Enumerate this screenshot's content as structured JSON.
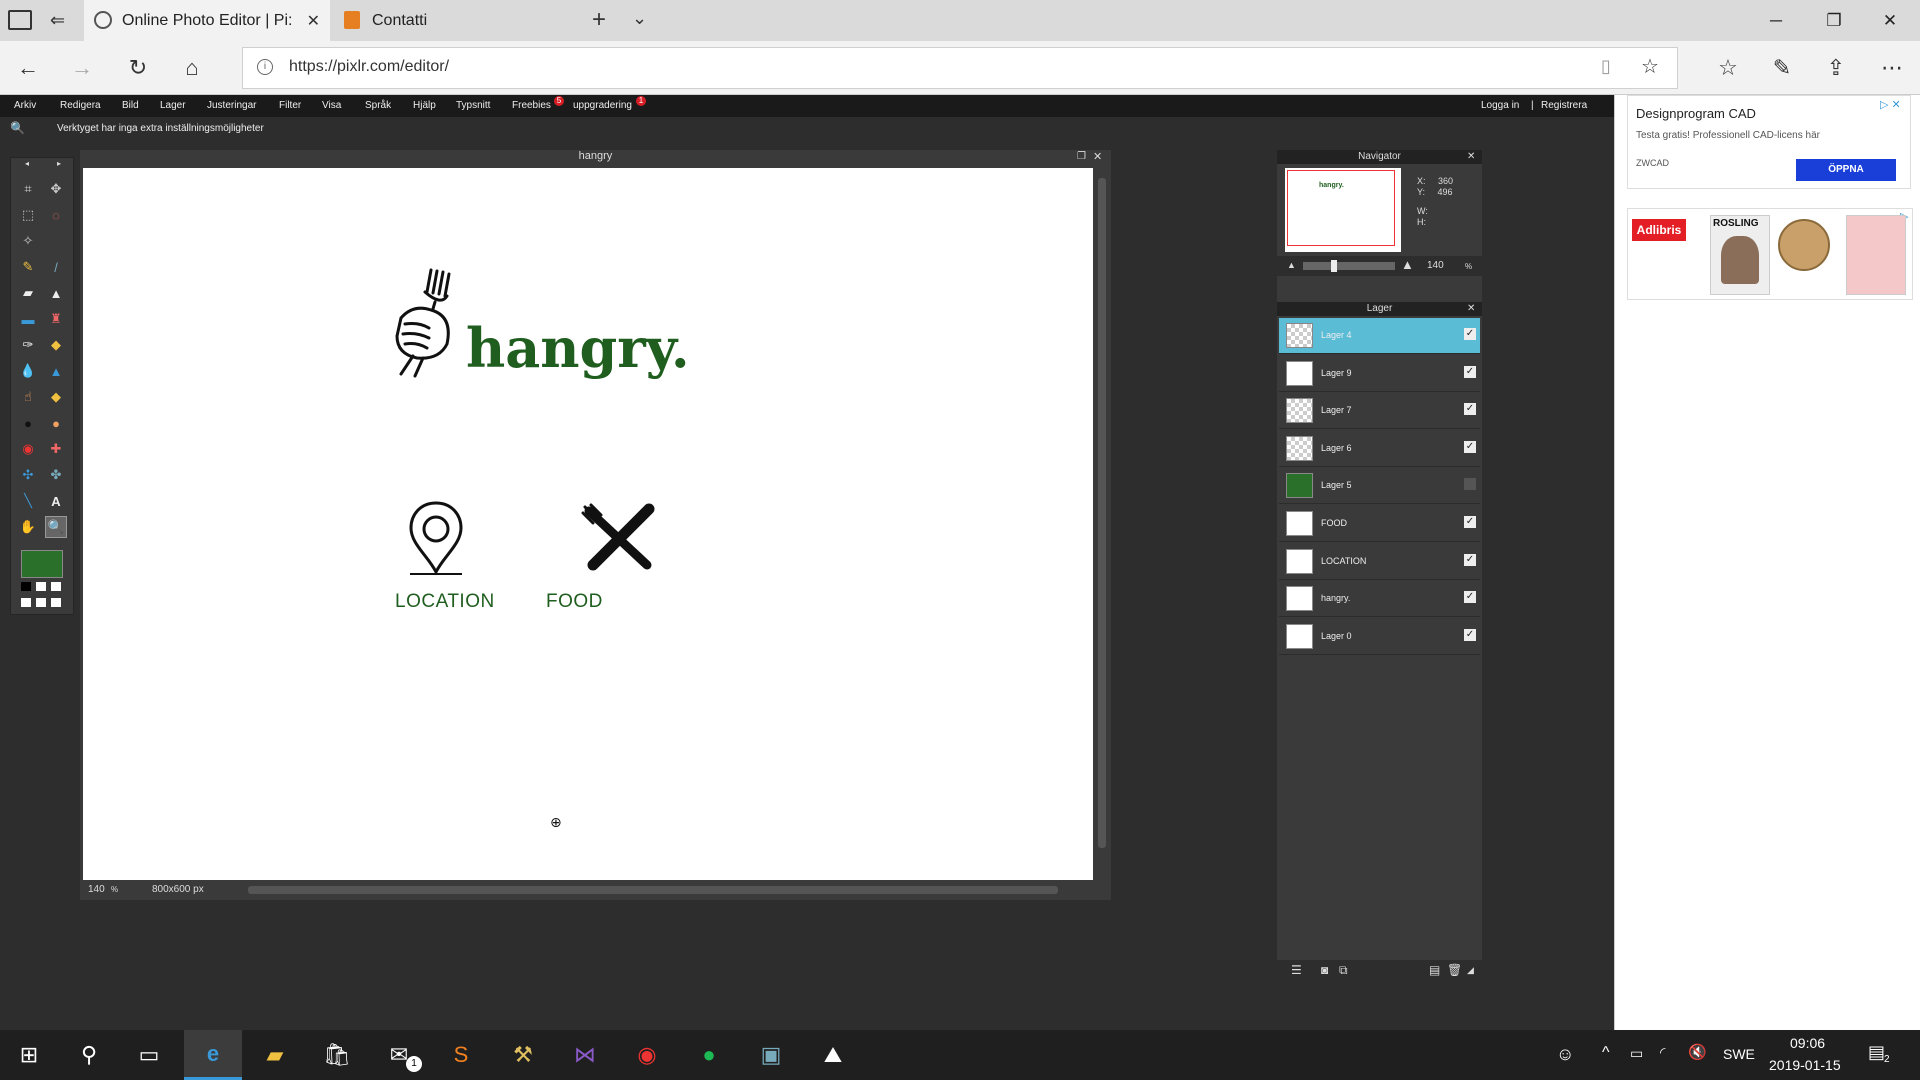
{
  "browser": {
    "tabs": [
      {
        "title": "Online Photo Editor | Pi:",
        "active": true
      },
      {
        "title": "Contatti",
        "active": false
      }
    ],
    "url": "https://pixlr.com/editor/"
  },
  "pixlr": {
    "menu": [
      "Arkiv",
      "Redigera",
      "Bild",
      "Lager",
      "Justeringar",
      "Filter",
      "Visa",
      "Språk",
      "Hjälp",
      "Typsnitt",
      "Freebies",
      "uppgradering"
    ],
    "freebies_badge": "5",
    "upgrade_badge": "1",
    "account": {
      "login": "Logga in",
      "separator": "|",
      "register": "Registrera"
    },
    "tool_hint": "Verktyget har inga extra inställningsmöjligheter",
    "document": {
      "title": "hangry",
      "zoom": "140",
      "zoom_unit": "%",
      "size": "800x600 px"
    },
    "canvas": {
      "logo_text": "hangry.",
      "location_label": "LOCATION",
      "food_label": "FOOD",
      "primary_color": "#1f5e1f"
    },
    "navigator": {
      "title": "Navigator",
      "x_label": "X:",
      "x": "360",
      "y_label": "Y:",
      "y": "496",
      "w_label": "W:",
      "h_label": "H:",
      "zoom": "140",
      "zoom_unit": "%"
    },
    "layers_panel": {
      "title": "Lager",
      "layers": [
        {
          "name": "Lager 4",
          "checked": true,
          "selected": true,
          "thumb": "transparent"
        },
        {
          "name": "Lager 9",
          "checked": true,
          "selected": false,
          "thumb": "white"
        },
        {
          "name": "Lager 7",
          "checked": true,
          "selected": false,
          "thumb": "transparent"
        },
        {
          "name": "Lager 6",
          "checked": true,
          "selected": false,
          "thumb": "transparent"
        },
        {
          "name": "Lager 5",
          "checked": false,
          "selected": false,
          "thumb": "green"
        },
        {
          "name": "FOOD",
          "checked": true,
          "selected": false,
          "thumb": "white"
        },
        {
          "name": "LOCATION",
          "checked": true,
          "selected": false,
          "thumb": "white"
        },
        {
          "name": "hangry.",
          "checked": true,
          "selected": false,
          "thumb": "white"
        },
        {
          "name": "Lager 0",
          "checked": true,
          "selected": false,
          "thumb": "white"
        }
      ]
    }
  },
  "ads": {
    "ad1_title": "Designprogram CAD",
    "ad1_desc": "Testa gratis! Professionell CAD-licens här",
    "ad1_brand": "ZWCAD",
    "ad1_cta": "ÖPPNA",
    "ad2_brand": "Adlibris",
    "ad2_book": "ROSLING"
  },
  "taskbar": {
    "mail_badge": "1",
    "language": "SWE",
    "time": "09:06",
    "date": "2019-01-15",
    "notifications": "2"
  }
}
